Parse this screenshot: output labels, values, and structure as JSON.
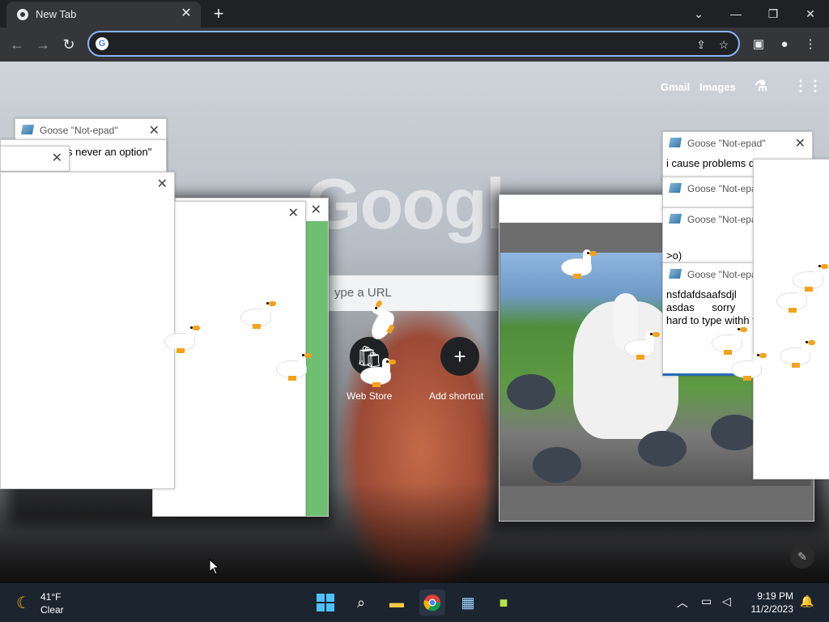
{
  "browser": {
    "tab_title": "New Tab",
    "new_tab_label": "+",
    "address_value": "",
    "window_controls": {
      "dropdown": "⌄",
      "minimize": "—",
      "restore": "❐",
      "close": "✕"
    }
  },
  "newtab_page": {
    "logo_text": "Googl",
    "links": {
      "gmail": "Gmail",
      "images": "Images"
    },
    "search_placeholder": "ype a URL",
    "shortcuts": [
      {
        "label": "Web Store"
      },
      {
        "label": "Add shortcut"
      }
    ]
  },
  "notepads": [
    {
      "title": "Goose \"Not-epad\"",
      "text": ""
    },
    {
      "title": "",
      "text": "s never an option\""
    },
    {
      "title": "",
      "text": ""
    },
    {
      "title": "",
      "text": ""
    },
    {
      "title": "Goose \"Not-epad\"",
      "text": "i cause problems d"
    },
    {
      "title": "Goose \"Not-epad\"",
      "text": ""
    },
    {
      "title": "Goose \"Not-epad",
      "text": ">o)"
    },
    {
      "title": "Goose \"Not-epa",
      "text": "nsfdafdsaafsdjl\nasdas      sorry\nhard to type withh f"
    }
  ],
  "taskbar": {
    "weather": {
      "temp": "41°F",
      "condition": "Clear"
    },
    "clock": {
      "time": "9:19 PM",
      "date": "11/2/2023"
    }
  },
  "colors": {
    "accent": "#8ab4f8",
    "tab_bg": "#35363a",
    "titlebar": "#202124",
    "taskbar": "#1c2430"
  }
}
